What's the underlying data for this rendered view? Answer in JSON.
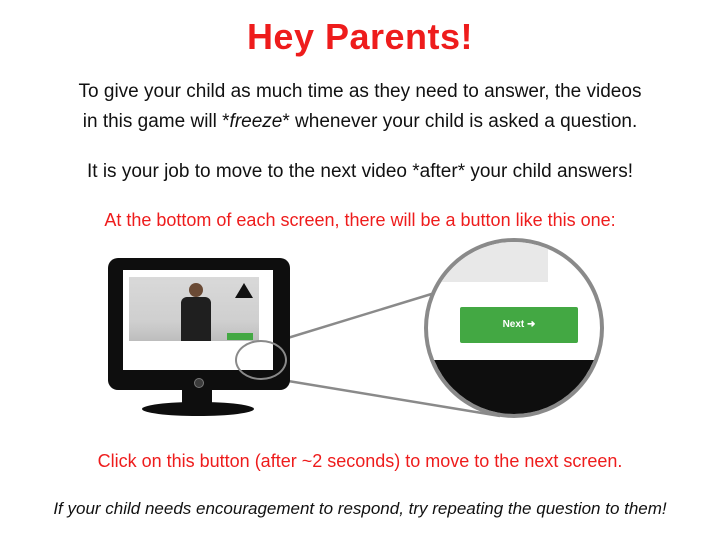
{
  "title": "Hey Parents!",
  "para1": {
    "line1": "To give your child as much time as they need to answer, the videos",
    "line2_a": "in this game will *",
    "line2_em": "freeze",
    "line2_b": "* whenever your child is asked a question."
  },
  "para2": "It is your job to move to the next video *after* your child answers!",
  "para3": "At the bottom of each screen, there will be a button like this one:",
  "next_button": {
    "label": "Next",
    "arrow": "➜"
  },
  "para4": "Click on this button (after ~2 seconds) to move to the next screen.",
  "para5": "If your child needs encouragement to respond, try repeating the question to them!",
  "colors": {
    "title": "#ee1c1c",
    "highlight": "#ee1c1c",
    "button": "#43a843"
  },
  "icons": [
    "monitor-icon",
    "magnifier-circle-icon",
    "arrow-right-icon",
    "triangle-icon"
  ]
}
